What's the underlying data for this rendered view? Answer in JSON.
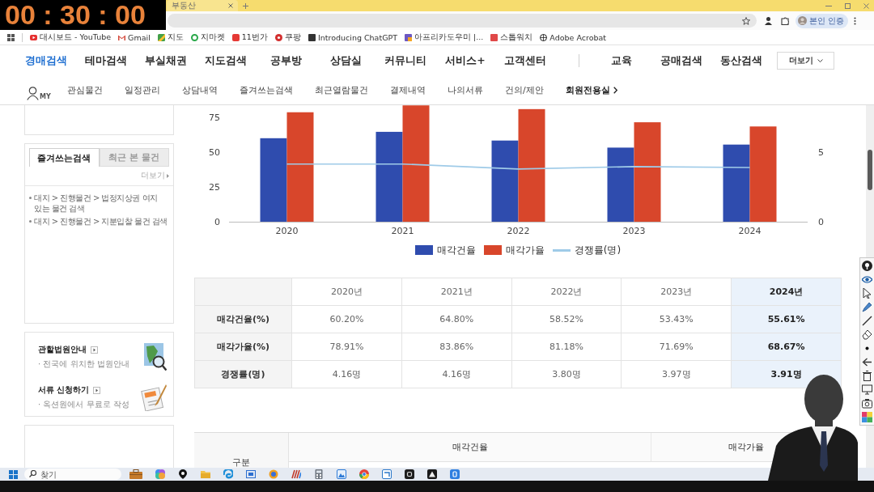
{
  "timer": {
    "text": "00 : 30 : 00"
  },
  "browser": {
    "tab_title": "부동산",
    "profile_label": "본인 인증",
    "bookmarks": [
      "대시보드 - YouTube",
      "Gmail",
      "지도",
      "지마켓",
      "11번가",
      "쿠팡",
      "Introducing ChatGPT",
      "아프리카도우미 |...",
      "스톱워치",
      "Adobe Acrobat"
    ]
  },
  "site_nav": {
    "items": [
      {
        "label": "경매검색",
        "selected": true
      },
      {
        "label": "테마검색",
        "selected": false
      },
      {
        "label": "부실채권",
        "selected": false
      },
      {
        "label": "지도검색",
        "selected": false
      },
      {
        "label": "공부방",
        "selected": false
      },
      {
        "label": "상담실",
        "selected": false
      },
      {
        "label": "커뮤니티",
        "selected": false
      },
      {
        "label": "서비스+",
        "selected": false
      },
      {
        "label": "고객센터",
        "selected": false
      }
    ],
    "extra_items": [
      "교육",
      "공매검색",
      "동산검색"
    ],
    "more_button": "더보기"
  },
  "member_nav": {
    "icon_label": "MY",
    "items": [
      "관심물건",
      "일정관리",
      "상담내역",
      "즐겨쓰는검색",
      "최근열람물건",
      "결제내역",
      "나의서류",
      "건의/제안"
    ],
    "member_room": "회원전용실"
  },
  "sidebar": {
    "tabs": [
      {
        "label": "즐겨쓰는검색",
        "selected": true
      },
      {
        "label": "최근 본 물건",
        "selected": false
      }
    ],
    "more_link": "더보기",
    "saved_searches": [
      "대지 > 진행물건 > 법정지상권 여지 있는 물건 검색",
      "대지 > 진행물건 > 지분입찰 물건 검색"
    ],
    "services": [
      {
        "title": "관할법원안내",
        "description": "· 전국에 위치한 법원안내"
      },
      {
        "title": "서류 신청하기",
        "description": "· 옥션원에서 무료로 작성"
      }
    ]
  },
  "chart": {
    "chart_data": {
      "type": "bar",
      "categories": [
        "2020",
        "2021",
        "2022",
        "2023",
        "2024"
      ],
      "series": [
        {
          "name": "매각건율",
          "color": "#2f4cae",
          "type": "bar",
          "values": [
            60.2,
            64.8,
            58.52,
            53.43,
            55.61
          ]
        },
        {
          "name": "매각가율",
          "color": "#d8462b",
          "type": "bar",
          "values": [
            78.91,
            83.86,
            81.18,
            71.69,
            68.67
          ]
        },
        {
          "name": "경쟁률(명)",
          "color": "#9fcbe8",
          "type": "line",
          "axis": "y2",
          "values": [
            4.16,
            4.16,
            3.8,
            3.97,
            3.91
          ]
        }
      ],
      "stacked": false,
      "ylim": [
        0,
        84
      ],
      "yticks": [
        0,
        25,
        50,
        75
      ],
      "y2lim": [
        0,
        8.4
      ],
      "y2ticks": [
        0,
        5
      ],
      "legend": "bottom"
    }
  },
  "table": {
    "columns": [
      {
        "label": "2020년",
        "selected": false
      },
      {
        "label": "2021년",
        "selected": false
      },
      {
        "label": "2022년",
        "selected": false
      },
      {
        "label": "2023년",
        "selected": false
      },
      {
        "label": "2024년",
        "selected": true
      }
    ],
    "rows": [
      {
        "label": "매각건율(%)",
        "cells": [
          "60.20%",
          "64.80%",
          "58.52%",
          "53.43%",
          "55.61%"
        ]
      },
      {
        "label": "매각가율(%)",
        "cells": [
          "78.91%",
          "83.86%",
          "81.18%",
          "71.69%",
          "68.67%"
        ]
      },
      {
        "label": "경쟁률(명)",
        "cells": [
          "4.16명",
          "4.16명",
          "3.80명",
          "3.97명",
          "3.91명"
        ]
      }
    ]
  },
  "lower_table": {
    "row_header": "구분",
    "columns": [
      "매각건율",
      "매각가율"
    ]
  },
  "taskbar": {
    "search_placeholder": "찾기"
  }
}
